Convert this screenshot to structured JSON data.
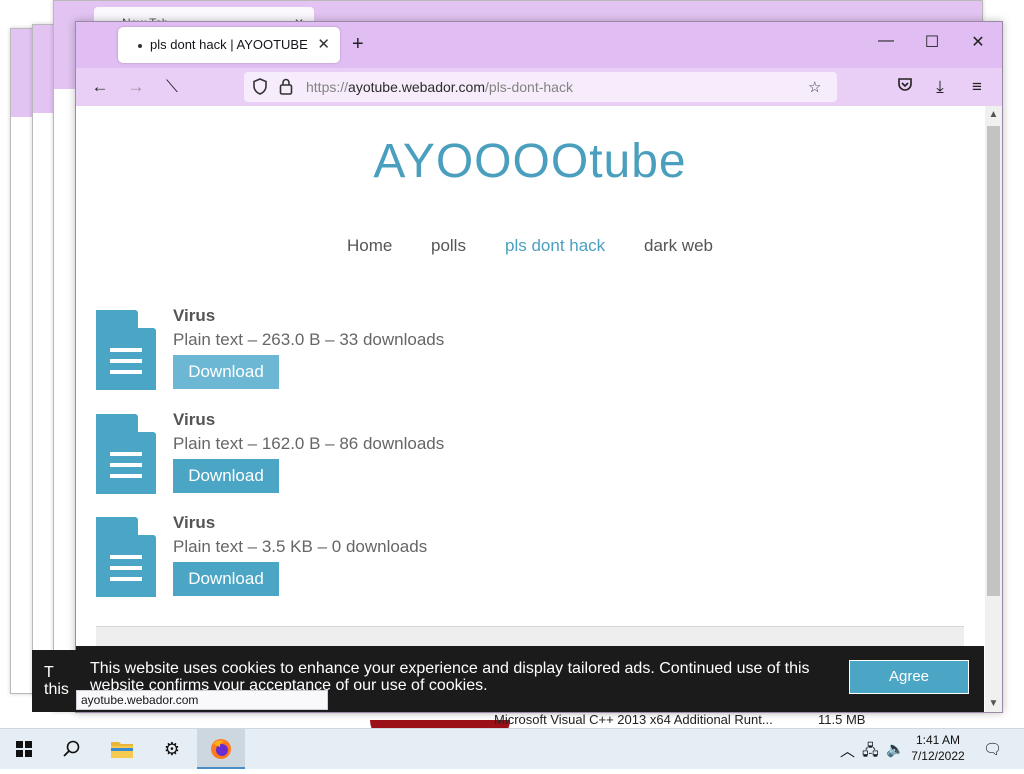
{
  "background_windows": {
    "tab_title": "New Tab"
  },
  "browser": {
    "tab_title": "pls dont hack | AYOOTUBE",
    "url_prefix": "https://",
    "url_domain": "ayotube.webador.com",
    "url_path": "/pls-dont-hack"
  },
  "site": {
    "logo": "AYOOOOtube",
    "nav": [
      {
        "label": "Home"
      },
      {
        "label": "polls"
      },
      {
        "label": "pls dont hack"
      },
      {
        "label": "dark web"
      }
    ],
    "files": [
      {
        "name": "Virus",
        "meta": "Plain text – 263.0 B – 33 downloads",
        "button": "Download"
      },
      {
        "name": "Virus",
        "meta": "Plain text – 162.0 B – 86 downloads",
        "button": "Download"
      },
      {
        "name": "Virus",
        "meta": "Plain text – 3.5 KB – 0 downloads",
        "button": "Download"
      }
    ]
  },
  "cookie_banner": {
    "text": "This website uses cookies to enhance your experience and display tailored ads. Continued use of this website confirms your acceptance of our use of cookies.",
    "agree": "Agree",
    "left_fragment": "T this"
  },
  "status_bar": {
    "url": "ayotube.webador.com"
  },
  "behind_window_row": {
    "text": "Microsoft Visual C++ 2013 x64 Additional Runt...",
    "size": "11.5 MB"
  },
  "taskbar": {
    "time": "1:41 AM",
    "date": "7/12/2022"
  },
  "colors": {
    "accent": "#4ba5c4",
    "titlebar": "#e0bdf3",
    "toolbar": "#e9cef6"
  }
}
